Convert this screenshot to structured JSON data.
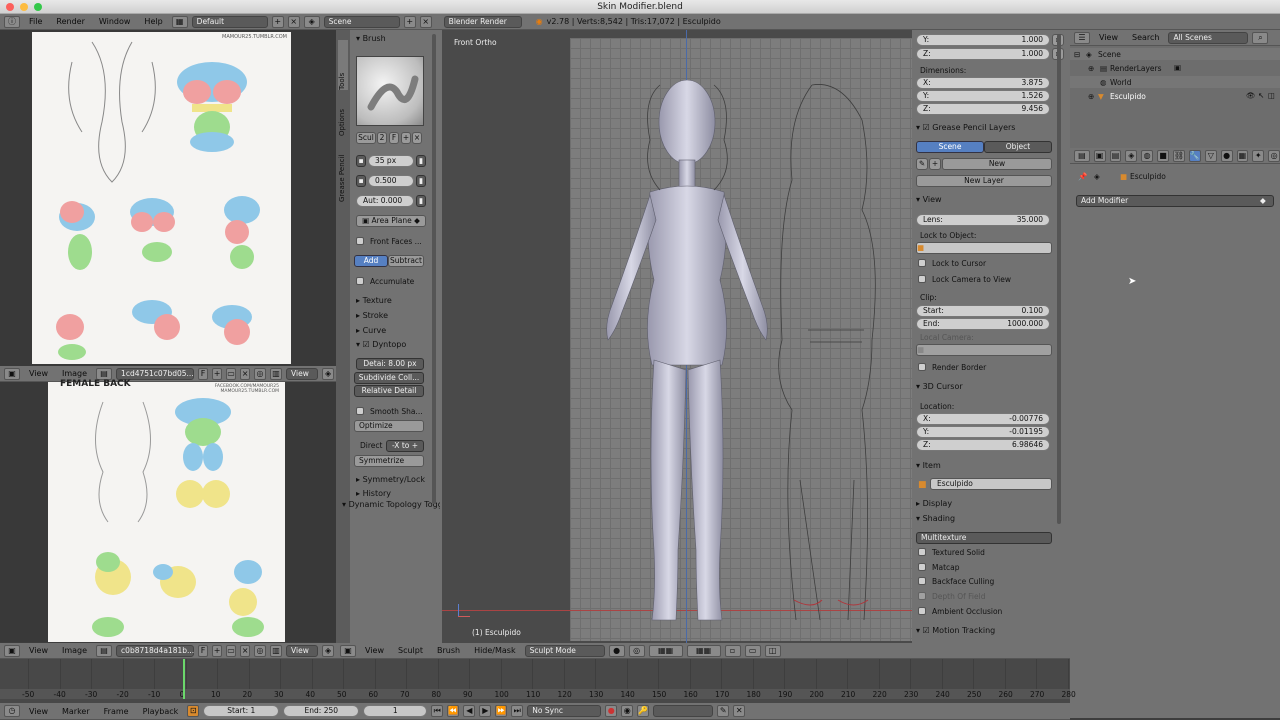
{
  "window": {
    "title": "Skin Modifier.blend"
  },
  "info_header": {
    "menus": [
      "File",
      "Render",
      "Window",
      "Help"
    ],
    "layout": "Default",
    "scene": "Scene",
    "engine": "Blender Render",
    "stats": "v2.78 | Verts:8,542 | Tris:17,072 | Esculpido"
  },
  "image_editor_top": {
    "menus": [
      "View",
      "Image"
    ],
    "image_name": "1cd4751c07bd05...",
    "view_label": "View",
    "watermark": "MAMOUR25.TUMBLR.COM"
  },
  "image_editor_bottom": {
    "menus": [
      "View",
      "Image"
    ],
    "image_name": "c0b8718d4a181b...",
    "view_label": "View",
    "heading": "FEMALE BACK",
    "watermark": "FACEBOOK.COM/MAMOUR25  MAMOUR25.TUMBLR.COM"
  },
  "tools": {
    "tabs": [
      "Tools",
      "Options",
      "Grease Pencil"
    ],
    "brush_header": "Brush",
    "scul": "Scul",
    "users": "2",
    "f": "F",
    "radius": "35 px",
    "strength": "0.500",
    "autosmooth": "Aut: 0.000",
    "plane": "Area Plane",
    "front_faces": "Front Faces ...",
    "add": "Add",
    "subtract": "Subtract",
    "accumulate": "Accumulate",
    "texture": "Texture",
    "stroke": "Stroke",
    "curve": "Curve",
    "dyntopo": "Dyntopo",
    "detail": "Detai: 8.00 px",
    "subdivide": "Subdivide Coll...",
    "relative": "Relative Detail",
    "smooth_shading": "Smooth Sha...",
    "optimize": "Optimize",
    "direct": "Direct",
    "direction": "-X to +",
    "symmetrize": "Symmetrize",
    "symmetry": "Symmetry/Lock",
    "history": "History",
    "last_op": "Dynamic Topology Togg"
  },
  "viewport": {
    "view_name": "Front Ortho",
    "object_label": "(1) Esculpido",
    "menus": [
      "View",
      "Sculpt",
      "Brush",
      "Hide/Mask"
    ],
    "mode": "Sculpt Mode"
  },
  "properties_n": {
    "y": "1.000",
    "z": "1.000",
    "dimensions": "Dimensions:",
    "dim_x": "3.875",
    "dim_y": "1.526",
    "dim_z": "9.456",
    "grease_pencil": "Grease Pencil Layers",
    "gp_scene": "Scene",
    "gp_object": "Object",
    "gp_new": "New",
    "gp_new_layer": "New Layer",
    "view": "View",
    "lens_label": "Lens:",
    "lens": "35.000",
    "lock_to_object": "Lock to Object:",
    "lock_cursor": "Lock to Cursor",
    "lock_camera": "Lock Camera to View",
    "clip": "Clip:",
    "clip_start_label": "Start:",
    "clip_start": "0.100",
    "clip_end_label": "End:",
    "clip_end": "1000.000",
    "local_camera": "Local Camera:",
    "render_border": "Render Border",
    "cursor": "3D Cursor",
    "location": "Location:",
    "cx": "-0.00776",
    "cy": "-0.01195",
    "cz": "6.98646",
    "item": "Item",
    "item_name": "Esculpido",
    "display": "Display",
    "shading": "Shading",
    "multitexture": "Multitexture",
    "textured_solid": "Textured Solid",
    "matcap": "Matcap",
    "backface": "Backface Culling",
    "depth_of_field": "Depth Of Field",
    "ambient": "Ambient Occlusion",
    "motion_tracking": "Motion Tracking",
    "x_label": "X:",
    "y_label": "Y:",
    "z_label": "Z:"
  },
  "outliner": {
    "menus": [
      "View",
      "Search"
    ],
    "filter": "All Scenes",
    "scene": "Scene",
    "renderlayers": "RenderLayers",
    "world": "World",
    "object": "Esculpido"
  },
  "modifiers": {
    "object": "Esculpido",
    "add": "Add Modifier"
  },
  "timeline": {
    "ticks": [
      "-50",
      "-40",
      "-30",
      "-20",
      "-10",
      "0",
      "10",
      "20",
      "30",
      "40",
      "50",
      "60",
      "70",
      "80",
      "90",
      "100",
      "110",
      "120",
      "130",
      "140",
      "150",
      "160",
      "170",
      "180",
      "190",
      "200",
      "210",
      "220",
      "230",
      "240",
      "250",
      "260",
      "270",
      "280"
    ],
    "menus": [
      "View",
      "Marker",
      "Frame",
      "Playback"
    ],
    "start_label": "Start:",
    "start": "1",
    "end_label": "End:",
    "end": "250",
    "current": "1",
    "sync": "No Sync"
  }
}
